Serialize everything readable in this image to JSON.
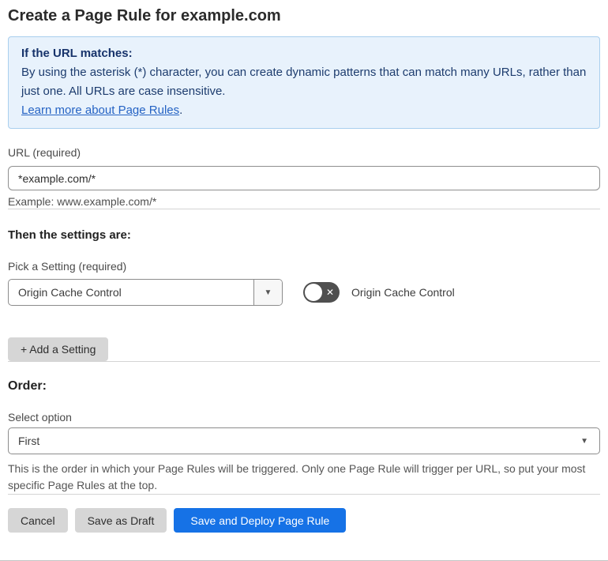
{
  "page": {
    "title": "Create a Page Rule for example.com"
  },
  "info_box": {
    "heading": "If the URL matches:",
    "body": "By using the asterisk (*) character, you can create dynamic patterns that can match many URLs, rather than just one. All URLs are case insensitive.",
    "link_text": "Learn more about Page Rules",
    "link_suffix": "."
  },
  "url_field": {
    "label": "URL (required)",
    "value": "*example.com/*",
    "helper": "Example: www.example.com/*"
  },
  "settings_section": {
    "heading": "Then the settings are:",
    "picker_label": "Pick a Setting (required)",
    "picker_value": "Origin Cache Control",
    "toggle_state": "off",
    "toggle_label": "Origin Cache Control",
    "add_button_label": "+ Add a Setting"
  },
  "order_section": {
    "heading": "Order:",
    "select_label": "Select option",
    "select_value": "First",
    "helper": "This is the order in which your Page Rules will be triggered. Only one Page Rule will trigger per URL, so put your most specific Page Rules at the top."
  },
  "footer": {
    "cancel_label": "Cancel",
    "save_draft_label": "Save as Draft",
    "save_deploy_label": "Save and Deploy Page Rule"
  },
  "icons": {
    "caret_down": "▼",
    "toggle_off_x": "✕"
  },
  "colors": {
    "info_bg": "#e8f2fc",
    "info_border": "#a9cfee",
    "info_text": "#1d3c6e",
    "link_blue": "#2563c4",
    "primary_button_blue": "#1672e6",
    "gray_button": "#d6d6d6",
    "toggle_track": "#4f4f4f"
  }
}
